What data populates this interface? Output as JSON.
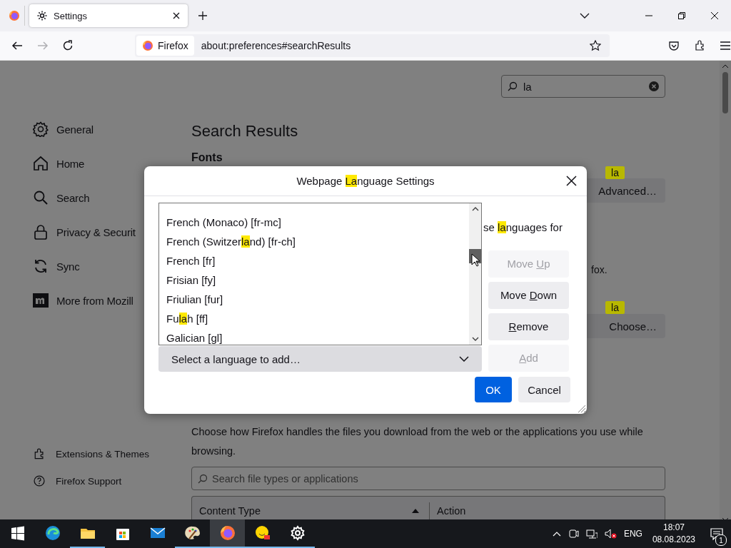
{
  "tabs": [
    {
      "title": "Settings",
      "selected": true
    }
  ],
  "nav": {
    "identity": "Firefox",
    "url": "about:preferences#searchResults"
  },
  "sidebar": {
    "items": [
      {
        "label": "General",
        "kind": "gear"
      },
      {
        "label": "Home",
        "kind": "home"
      },
      {
        "label": "Search",
        "kind": "search"
      },
      {
        "label": "Privacy & Securit",
        "kind": "lock"
      },
      {
        "label": "Sync",
        "kind": "sync"
      },
      {
        "label": "More from Mozill",
        "kind": "brand"
      }
    ],
    "footer": [
      {
        "label": "Extensions & Themes",
        "kind": "puzzle"
      },
      {
        "label": "Firefox Support",
        "kind": "help"
      }
    ]
  },
  "page": {
    "search_value": "la",
    "title": "Search Results",
    "fonts_heading": "Fonts",
    "advanced_button": "Advanced…",
    "advanced_badge": "la",
    "text_fragment": "fox.",
    "choose_button": "Choose…",
    "choose_badge": "la",
    "applications": {
      "description": "Choose how Firefox handles the files you download from the web or the applications you use while browsing.",
      "search_placeholder": "Search file types or applications",
      "columns": [
        {
          "label": "Content Type",
          "sorted": true
        },
        {
          "label": "Action",
          "sorted": false
        }
      ]
    }
  },
  "dialog": {
    "title": [
      {
        "text": "Webpage ",
        "highlighted": false
      },
      {
        "text": "La",
        "highlighted": true
      },
      {
        "text": "nguage Settings",
        "highlighted": false
      }
    ],
    "description": [
      {
        "text": "se ",
        "highlighted": false
      },
      {
        "text": "la",
        "highlighted": true
      },
      {
        "text": "nguages for",
        "highlighted": false
      }
    ],
    "languages": [
      {
        "parts": [
          {
            "text": "French (Monaco) [fr-mc]",
            "highlighted": false
          }
        ]
      },
      {
        "parts": [
          {
            "text": "French (Switzer",
            "highlighted": false
          },
          {
            "text": "la",
            "highlighted": true
          },
          {
            "text": "nd) [fr-ch]",
            "highlighted": false
          }
        ]
      },
      {
        "parts": [
          {
            "text": "French [fr]",
            "highlighted": false
          }
        ]
      },
      {
        "parts": [
          {
            "text": "Frisian [fy]",
            "highlighted": false
          }
        ]
      },
      {
        "parts": [
          {
            "text": "Friulian [fur]",
            "highlighted": false
          }
        ]
      },
      {
        "parts": [
          {
            "text": "Fu",
            "highlighted": false
          },
          {
            "text": "la",
            "highlighted": true
          },
          {
            "text": "h [ff]",
            "highlighted": false
          }
        ]
      },
      {
        "parts": [
          {
            "text": "Galician [gl]",
            "highlighted": false
          }
        ]
      }
    ],
    "select_label": "Select a language to add…",
    "buttons": [
      {
        "disabled": true,
        "parts": [
          {
            "text": "Move ",
            "accesskey": false
          },
          {
            "text": "U",
            "accesskey": true
          },
          {
            "text": "p",
            "accesskey": false
          }
        ]
      },
      {
        "disabled": false,
        "parts": [
          {
            "text": "Move ",
            "accesskey": false
          },
          {
            "text": "D",
            "accesskey": true
          },
          {
            "text": "own",
            "accesskey": false
          }
        ]
      },
      {
        "disabled": false,
        "parts": [
          {
            "text": "R",
            "accesskey": true
          },
          {
            "text": "emove",
            "accesskey": false
          }
        ]
      },
      {
        "disabled": true,
        "parts": [
          {
            "text": "A",
            "accesskey": true
          },
          {
            "text": "dd",
            "accesskey": false
          }
        ]
      }
    ],
    "ok": "OK",
    "cancel": "Cancel"
  },
  "taskbar": {
    "apps": [
      {
        "kind": "start",
        "active": false,
        "running": false
      },
      {
        "kind": "edge",
        "active": false,
        "running": false
      },
      {
        "kind": "folder",
        "active": false,
        "running": true
      },
      {
        "kind": "store",
        "active": false,
        "running": false
      },
      {
        "kind": "mail",
        "active": false,
        "running": false
      },
      {
        "kind": "paint",
        "active": false,
        "running": true
      },
      {
        "kind": "firefox",
        "active": true,
        "running": true
      },
      {
        "kind": "smiley",
        "active": false,
        "running": true
      },
      {
        "kind": "gear",
        "active": false,
        "running": true
      }
    ],
    "language": "ENG",
    "time": "18:07",
    "date": "08.08.2023",
    "notifications": "1"
  }
}
